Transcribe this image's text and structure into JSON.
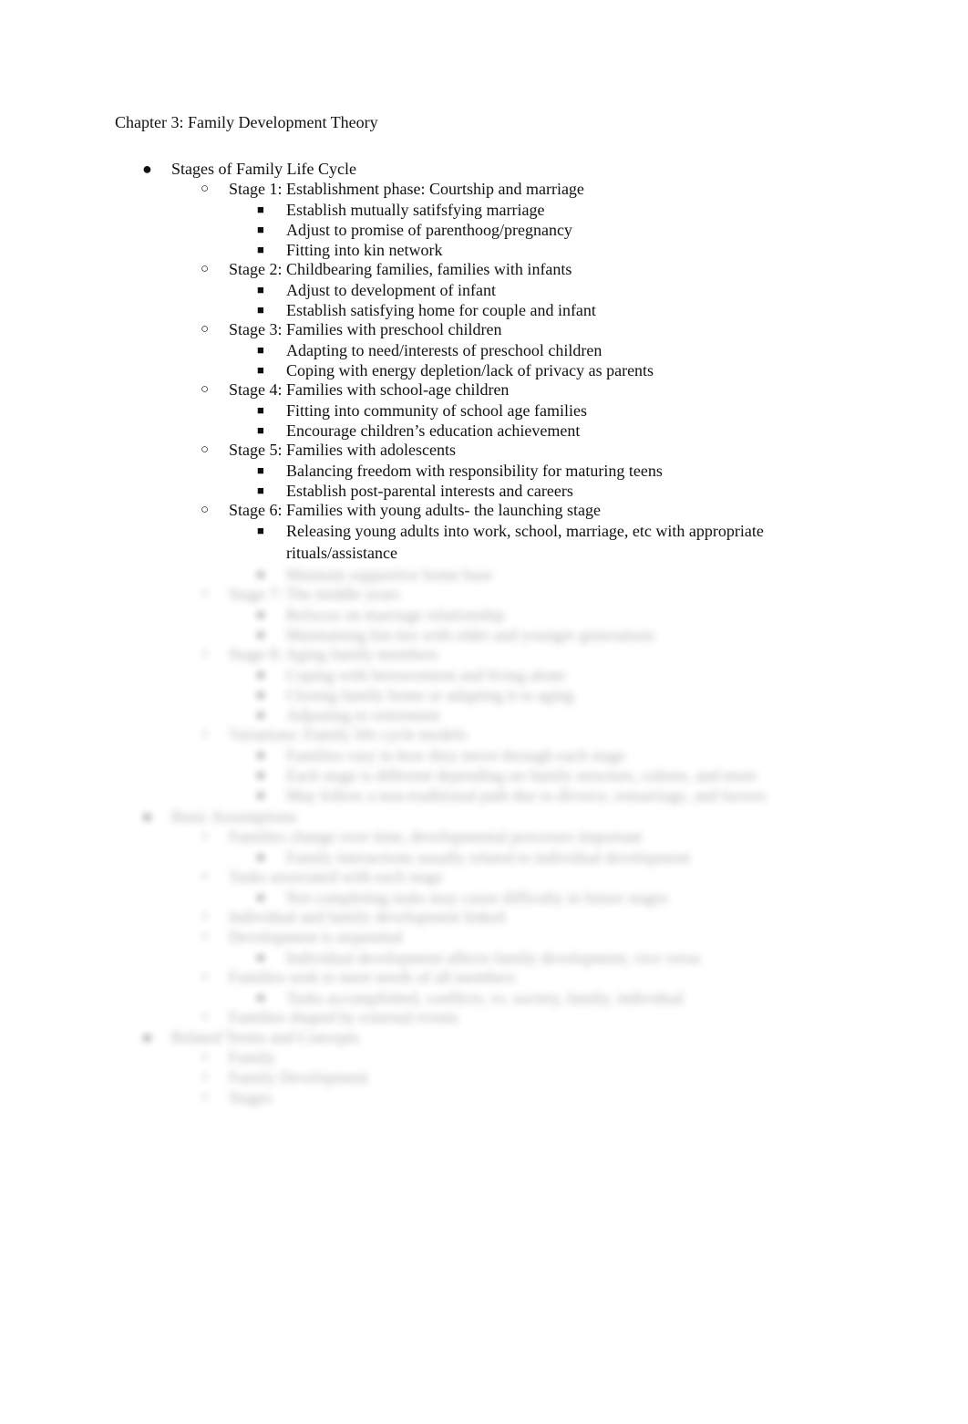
{
  "document": {
    "title": "Chapter 3: Family Development Theory",
    "outline": [
      {
        "level": 1,
        "text": "Stages of Family Life Cycle",
        "blurred": false
      },
      {
        "level": 2,
        "text": "Stage 1: Establishment phase: Courtship and marriage",
        "blurred": false
      },
      {
        "level": 3,
        "text": "Establish mutually satifsfying marriage",
        "blurred": false
      },
      {
        "level": 3,
        "text": "Adjust to promise of parenthoog/pregnancy",
        "blurred": false
      },
      {
        "level": 3,
        "text": "Fitting into kin network",
        "blurred": false
      },
      {
        "level": 2,
        "text": "Stage 2: Childbearing families, families with infants",
        "blurred": false
      },
      {
        "level": 3,
        "text": "Adjust to development of infant",
        "blurred": false
      },
      {
        "level": 3,
        "text": "Establish satisfying home for couple and infant",
        "blurred": false
      },
      {
        "level": 2,
        "text": "Stage 3: Families with preschool children",
        "blurred": false
      },
      {
        "level": 3,
        "text": "Adapting to need/interests of preschool children",
        "blurred": false
      },
      {
        "level": 3,
        "text": "Coping with energy depletion/lack of privacy as parents",
        "blurred": false
      },
      {
        "level": 2,
        "text": "Stage 4: Families with school-age children",
        "blurred": false
      },
      {
        "level": 3,
        "text": "Fitting into community of school age families",
        "blurred": false
      },
      {
        "level": 3,
        "text": "Encourage children’s education achievement",
        "blurred": false
      },
      {
        "level": 2,
        "text": "Stage 5: Families with adolescents",
        "blurred": false
      },
      {
        "level": 3,
        "text": "Balancing freedom with responsibility for maturing teens",
        "blurred": false
      },
      {
        "level": 3,
        "text": "Establish post-parental interests and careers",
        "blurred": false
      },
      {
        "level": 2,
        "text": "Stage 6: Families with young adults- the launching stage",
        "blurred": false
      },
      {
        "level": 3,
        "text": "Releasing young adults into work, school, marriage, etc with appropriate rituals/assistance",
        "blurred": false,
        "wrap": true
      },
      {
        "level": 3,
        "text": "Maintain supportive home base",
        "blurred": true
      },
      {
        "level": 2,
        "text": "Stage 7: The middle years",
        "blurred": true
      },
      {
        "level": 3,
        "text": "Refocus on marriage relationship",
        "blurred": true
      },
      {
        "level": 3,
        "text": "Maintaining kin ties with older and younger generations",
        "blurred": true
      },
      {
        "level": 2,
        "text": "Stage 8: Aging family members",
        "blurred": true
      },
      {
        "level": 3,
        "text": "Coping with bereavement and living alone",
        "blurred": true
      },
      {
        "level": 3,
        "text": "Closing family home or adapting it to aging",
        "blurred": true
      },
      {
        "level": 3,
        "text": "Adjusting to retirement",
        "blurred": true
      },
      {
        "level": 2,
        "text": "Variations: Family life cycle models",
        "blurred": true
      },
      {
        "level": 3,
        "text": "Families vary in how they move through each stage",
        "blurred": true
      },
      {
        "level": 3,
        "text": "Each stage is different depending on family structure, culture, and more",
        "blurred": true
      },
      {
        "level": 3,
        "text": "May follow a non-traditional path due to divorce, remarriage, and factors",
        "blurred": true,
        "wrap": true
      },
      {
        "level": 1,
        "text": "Basic Assumptions",
        "blurred": true
      },
      {
        "level": 2,
        "text": "Families change over time, developmental processes important",
        "blurred": true
      },
      {
        "level": 3,
        "text": "Family interactions usually related to individual development",
        "blurred": true
      },
      {
        "level": 2,
        "text": "Tasks associated with each stage",
        "blurred": true
      },
      {
        "level": 3,
        "text": "Not completing tasks may cause difficulty in future stages",
        "blurred": true
      },
      {
        "level": 2,
        "text": "Individual and family development linked",
        "blurred": true
      },
      {
        "level": 2,
        "text": "Development is sequential",
        "blurred": true
      },
      {
        "level": 3,
        "text": "Individual development affects family development, vice versa",
        "blurred": true
      },
      {
        "level": 2,
        "text": "Families seek to meet needs of all members",
        "blurred": true
      },
      {
        "level": 3,
        "text": "Tasks accomplished, conflicts, vs. society, family, individual",
        "blurred": true
      },
      {
        "level": 2,
        "text": "Families shaped by external events",
        "blurred": true
      },
      {
        "level": 1,
        "text": "Related Terms and Concepts",
        "blurred": true
      },
      {
        "level": 2,
        "text": "Family",
        "blurred": true
      },
      {
        "level": 2,
        "text": "Family Development",
        "blurred": true
      },
      {
        "level": 2,
        "text": "Stages",
        "blurred": true
      }
    ]
  },
  "bullets": {
    "1": "●",
    "2": "○",
    "3": "■"
  }
}
